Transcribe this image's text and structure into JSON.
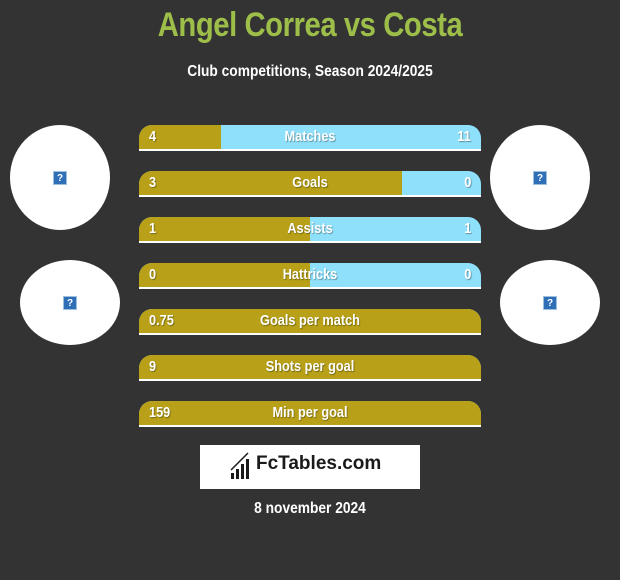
{
  "header": {
    "title": "Angel Correa vs Costa",
    "subtitle": "Club competitions, Season 2024/2025"
  },
  "colors": {
    "left": "#b8a118",
    "right": "#8fe0fb",
    "title": "#9dbf49",
    "background": "#333333"
  },
  "players": {
    "left": {
      "avatar_icon": "image-placeholder-icon",
      "club_icon": "image-placeholder-icon"
    },
    "right": {
      "avatar_icon": "image-placeholder-icon",
      "club_icon": "image-placeholder-icon"
    }
  },
  "stats": [
    {
      "label": "Matches",
      "left": "4",
      "right": "11",
      "left_share": 0.24
    },
    {
      "label": "Goals",
      "left": "3",
      "right": "0",
      "left_share": 0.77
    },
    {
      "label": "Assists",
      "left": "1",
      "right": "1",
      "left_share": 0.5
    },
    {
      "label": "Hattricks",
      "left": "0",
      "right": "0",
      "left_share": 0.5
    },
    {
      "label": "Goals per match",
      "left": "0.75",
      "right": "",
      "left_share": 1.0
    },
    {
      "label": "Shots per goal",
      "left": "9",
      "right": "",
      "left_share": 1.0
    },
    {
      "label": "Min per goal",
      "left": "159",
      "right": "",
      "left_share": 1.0
    }
  ],
  "footer": {
    "logo_text": "FcTables.com",
    "date": "8 november 2024"
  }
}
